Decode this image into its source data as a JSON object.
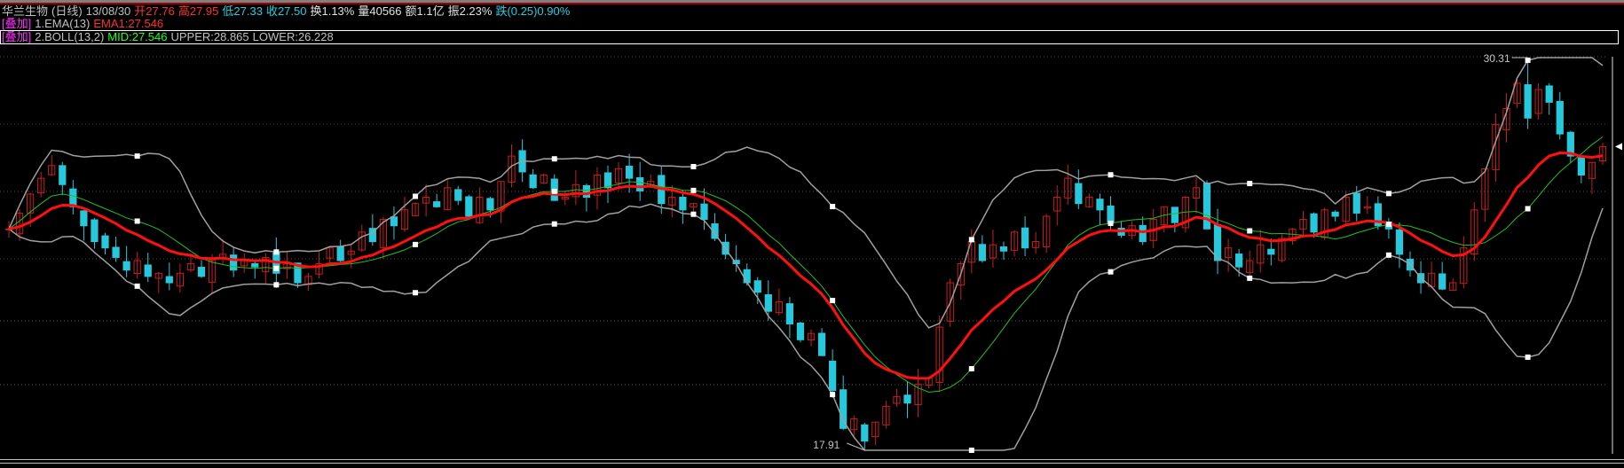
{
  "header": {
    "name": "华兰生物",
    "period": "(日线)",
    "date": "13/08/30",
    "open": "开27.76",
    "high": "高27.95",
    "low": "低27.33",
    "close": "收27.50",
    "turnover": "换1.13%",
    "volume": "量40566",
    "amount": "额1.1亿",
    "amplitude": "振2.23%",
    "change": "跌(0.25)0.90%"
  },
  "overlay1": {
    "tag": "[叠加]",
    "name": "1.EMA(13)",
    "ema": "EMA1:27.546"
  },
  "overlay2": {
    "tag": "[叠加]",
    "name": "2.BOLL(13,2)",
    "mid": "MID:27.546",
    "upper": "UPPER:28.865",
    "lower": "LOWER:26.228"
  },
  "colors": {
    "up": "#c81e1e",
    "down": "#28c8dc",
    "ema": "#ff1010",
    "mid": "#20c020",
    "bands": "#a0a0a0",
    "grid": "#505050"
  },
  "chart_data": {
    "type": "candlestick",
    "indicators": [
      "EMA(13)",
      "BOLL(13,2)"
    ],
    "max_label": "30.31",
    "min_label": "17.91",
    "price_range": [
      17.91,
      30.31
    ],
    "closes": [
      24.9,
      25.4,
      26.0,
      26.5,
      26.9,
      26.3,
      25.6,
      25.0,
      24.5,
      24.3,
      24.0,
      23.6,
      23.9,
      23.4,
      23.5,
      23.2,
      23.5,
      23.8,
      23.4,
      23.9,
      24.1,
      23.6,
      23.9,
      23.7,
      24.0,
      23.5,
      23.8,
      23.2,
      23.4,
      23.8,
      24.3,
      23.9,
      24.2,
      24.8,
      24.5,
      25.2,
      25.0,
      25.5,
      25.7,
      25.9,
      25.6,
      26.2,
      25.8,
      25.3,
      25.9,
      25.5,
      26.4,
      27.2,
      26.7,
      26.2,
      26.6,
      25.8,
      25.9,
      26.3,
      25.9,
      26.6,
      26.2,
      26.8,
      26.5,
      26.1,
      26.4,
      25.7,
      25.9,
      25.5,
      25.7,
      25.2,
      24.6,
      24.1,
      23.8,
      23.2,
      22.9,
      22.3,
      22.6,
      21.9,
      21.4,
      21.6,
      20.9,
      19.8,
      18.6,
      18.9,
      18.2,
      18.8,
      19.3,
      19.6,
      19.4,
      20.0,
      20.2,
      21.8,
      23.2,
      23.8,
      24.5,
      23.9,
      24.4,
      24.2,
      24.8,
      24.3,
      24.5,
      25.3,
      25.9,
      26.5,
      25.7,
      25.9,
      25.5,
      25.1,
      24.7,
      25.0,
      24.5,
      25.2,
      25.6,
      25.1,
      25.9,
      26.2,
      24.9,
      23.9,
      24.3,
      23.7,
      23.9,
      24.4,
      24.1,
      24.6,
      24.9,
      25.2,
      24.8,
      25.5,
      25.3,
      25.9,
      25.4,
      25.6,
      25.0,
      24.9,
      24.1,
      23.6,
      23.2,
      23.5,
      23.0,
      23.2,
      24.3,
      25.5,
      26.8,
      28.2,
      28.7,
      29.5,
      28.4,
      29.3,
      28.9,
      27.9,
      27.2,
      26.6,
      27.0,
      27.5
    ]
  }
}
